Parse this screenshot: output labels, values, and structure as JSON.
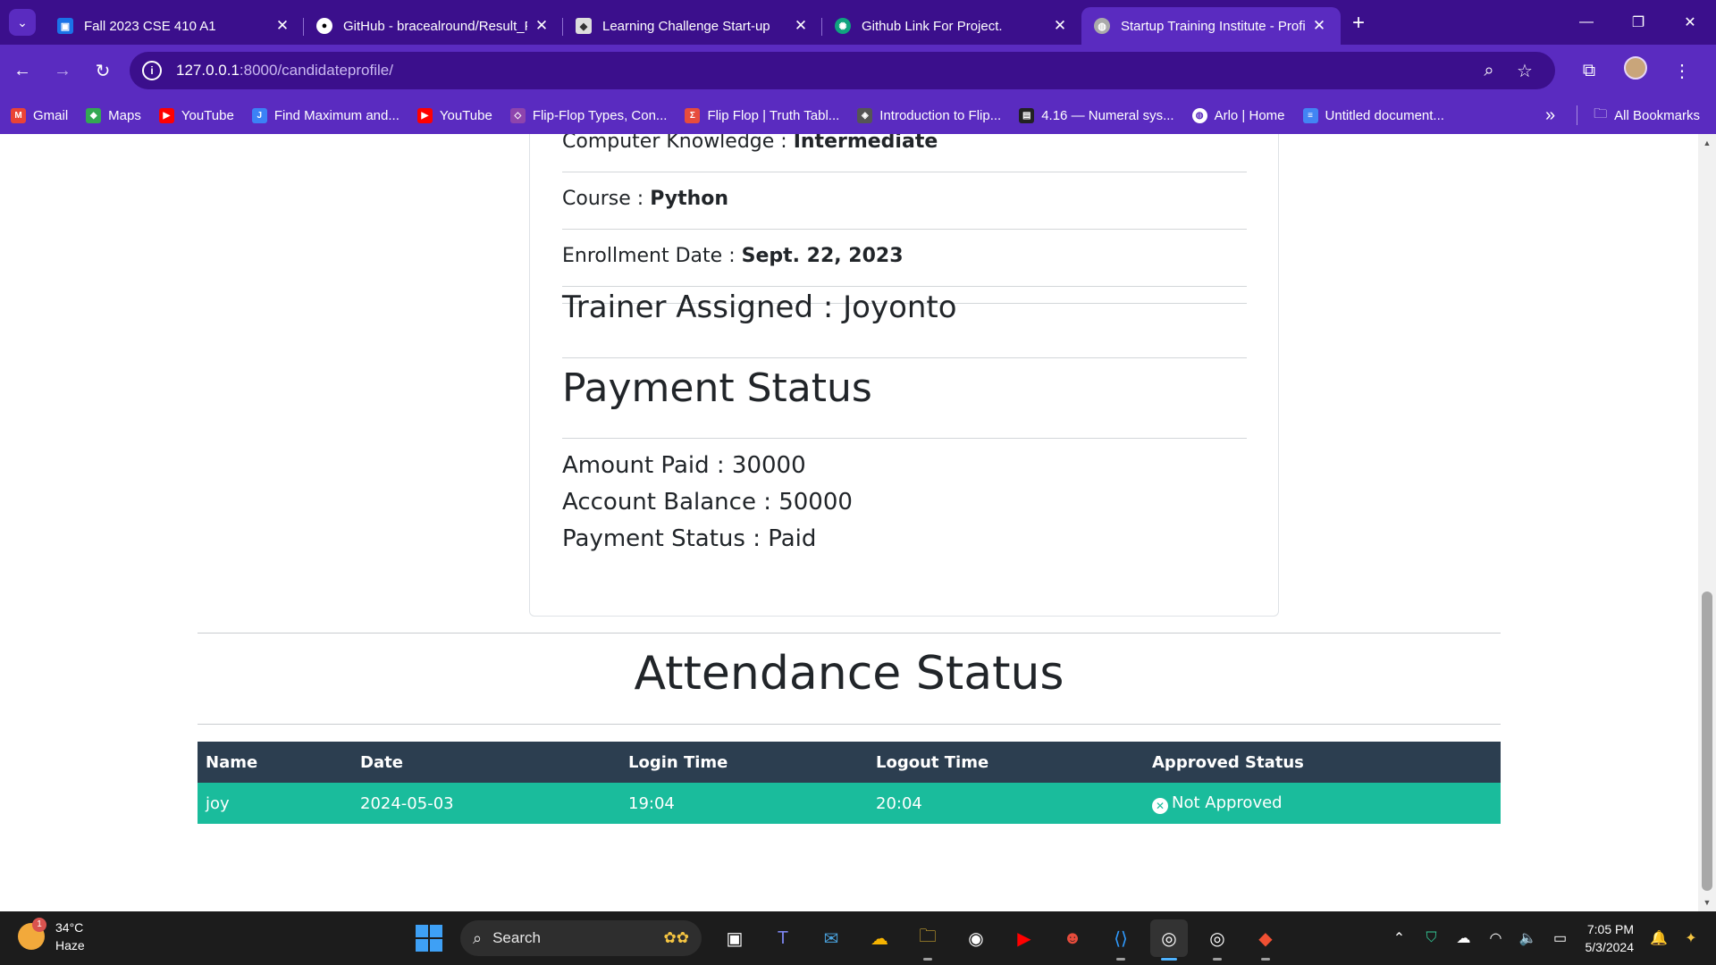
{
  "browser": {
    "tabs": [
      {
        "title": "Fall 2023 CSE 410 A1",
        "icon": "classroom-icon",
        "color": "#1a73e8"
      },
      {
        "title": "GitHub - bracealround/Result_P",
        "icon": "github-icon",
        "color": "#ffffff"
      },
      {
        "title": "Learning Challenge Start-up",
        "icon": "site-icon",
        "color": "#dddddd"
      },
      {
        "title": "Github Link For Project.",
        "icon": "chatgpt-icon",
        "color": "#10a37f"
      },
      {
        "title": "Startup Training Institute - Profi",
        "icon": "globe-icon",
        "color": "#aaaaaa"
      }
    ],
    "active_tab_index": 4,
    "address": {
      "host": "127.0.0.1",
      "path": ":8000/candidateprofile/"
    },
    "bookmarks": [
      {
        "label": "Gmail",
        "icon": "gmail-icon",
        "color": "#ea4335"
      },
      {
        "label": "Maps",
        "icon": "maps-icon",
        "color": "#34a853"
      },
      {
        "label": "YouTube",
        "icon": "youtube-icon",
        "color": "#ff0000"
      },
      {
        "label": "Find Maximum and...",
        "icon": "bookmark-icon",
        "color": "#3b82f6"
      },
      {
        "label": "YouTube",
        "icon": "youtube-icon",
        "color": "#ff0000"
      },
      {
        "label": "Flip-Flop Types, Con...",
        "icon": "bookmark-icon",
        "color": "#8e44ad"
      },
      {
        "label": "Flip Flop | Truth Tabl...",
        "icon": "sigma-icon",
        "color": "#e74c3c"
      },
      {
        "label": "Introduction to Flip...",
        "icon": "shield-icon",
        "color": "#555555"
      },
      {
        "label": "4.16 — Numeral sys...",
        "icon": "bookmark-icon",
        "color": "#222222"
      },
      {
        "label": "Arlo | Home",
        "icon": "globe-icon",
        "color": "#ffffff"
      },
      {
        "label": "Untitled document...",
        "icon": "docs-icon",
        "color": "#4285f4"
      }
    ],
    "all_bookmarks_label": "All Bookmarks"
  },
  "profile": {
    "computer_knowledge_label": "Computer Knowledge :",
    "computer_knowledge_value": "Intermediate",
    "course_label": "Course :",
    "course_value": "Python",
    "enrollment_label": "Enrollment Date :",
    "enrollment_value": "Sept. 22, 2023",
    "trainer": "Trainer Assigned : Joyonto"
  },
  "payment": {
    "heading": "Payment Status",
    "amount_paid": "Amount Paid : 30000",
    "account_balance": "Account Balance : 50000",
    "status": "Payment Status : Paid"
  },
  "attendance": {
    "heading": "Attendance Status",
    "columns": [
      "Name",
      "Date",
      "Login Time",
      "Logout Time",
      "Approved Status"
    ],
    "rows": [
      {
        "name": "joy",
        "date": "2024-05-03",
        "login": "19:04",
        "logout": "20:04",
        "status": "Not Approved"
      }
    ]
  },
  "taskbar": {
    "weather_temp": "34°C",
    "weather_desc": "Haze",
    "weather_badge": "1",
    "search_placeholder": "Search",
    "time": "7:05 PM",
    "date": "5/3/2024"
  }
}
